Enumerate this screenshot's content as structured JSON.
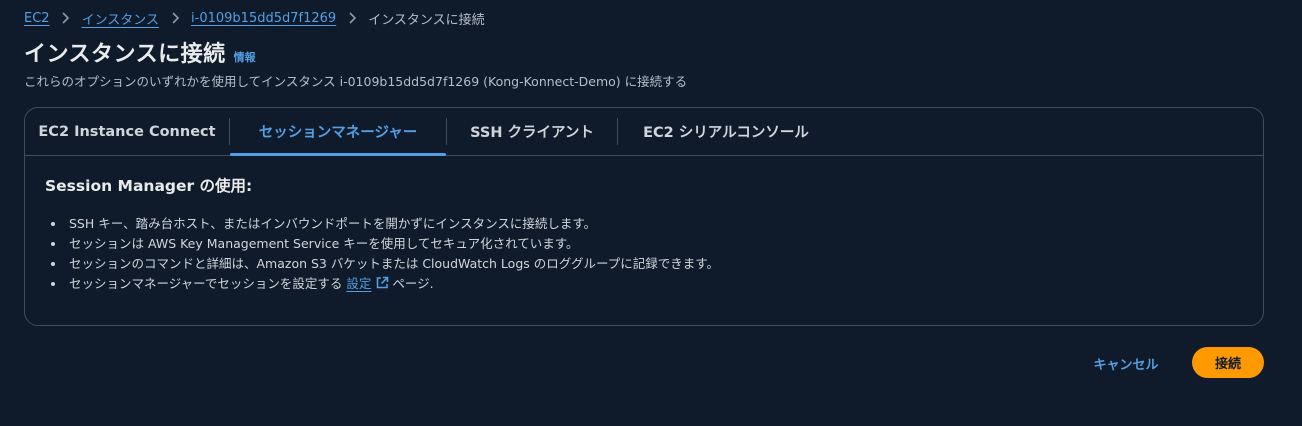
{
  "breadcrumb": {
    "items": [
      {
        "label": "EC2"
      },
      {
        "label": "インスタンス"
      },
      {
        "label": "i-0109b15dd5d7f1269"
      }
    ],
    "current": "インスタンスに接続"
  },
  "header": {
    "title": "インスタンスに接続",
    "info_label": "情報",
    "description": "これらのオプションのいずれかを使用してインスタンス i-0109b15dd5d7f1269 (Kong-Konnect-Demo) に接続する"
  },
  "tabs": [
    {
      "label": "EC2 Instance Connect",
      "active": false
    },
    {
      "label": "セッションマネージャー",
      "active": true
    },
    {
      "label": "SSH クライアント",
      "active": false
    },
    {
      "label": "EC2 シリアルコンソール",
      "active": false
    }
  ],
  "panel": {
    "heading": "Session Manager の使用:",
    "bullets": [
      "SSH キー、踏み台ホスト、またはインバウンドポートを開かずにインスタンスに接続します。",
      "セッションは AWS Key Management Service キーを使用してセキュア化されています。",
      "セッションのコマンドと詳細は、Amazon S3 バケットまたは CloudWatch Logs のロググループに記録できます。"
    ],
    "last_bullet": {
      "prefix": "セッションマネージャーでセッションを設定する",
      "link": "設定",
      "suffix": "ページ."
    }
  },
  "footer": {
    "cancel_label": "キャンセル",
    "connect_label": "接続"
  },
  "icons": {
    "chevron": "chevron-right-icon",
    "external": "external-link-icon"
  },
  "colors": {
    "background": "#0f1b2a",
    "link": "#539fe5",
    "primary_button": "#ff9900",
    "border": "#414d5c"
  }
}
